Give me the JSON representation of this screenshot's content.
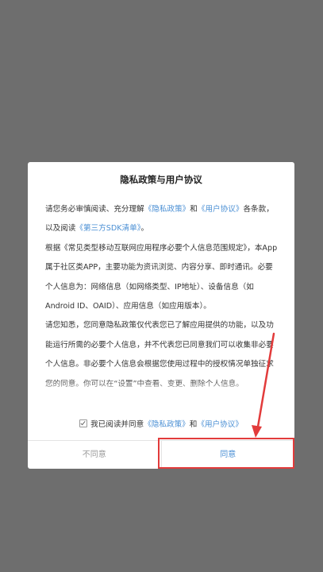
{
  "dialog": {
    "title": "隐私政策与用户协议",
    "paragraph1": {
      "prefix": "请您务必审慎阅读、充分理解",
      "privacy_link": "《隐私政策》",
      "and": "和",
      "terms_link": "《用户协议》",
      "middle": "各条款，以及阅读",
      "sdk_link": "《第三方SDK清单》",
      "end": "。"
    },
    "paragraph2": "根据《常见类型移动互联网应用程序必要个人信息范围规定》，本App属于社区类APP，主要功能为资讯浏览、内容分享、即时通讯。必要个人信息为：网络信息（如网络类型、IP地址）、设备信息（如Android ID、OAID）、应用信息（如应用版本）。",
    "paragraph3": "请您知悉，您同意隐私政策仅代表您已了解应用提供的功能，以及功能运行所需的必要个人信息，并不代表您已同意我们可以收集非必要个人信息。非必要个人信息会根据您使用过程中的授权情况单独征求您的同意。你可以在“设置”中查看、变更、删除个人信息。",
    "consent": {
      "prefix": "我已阅读并同意",
      "privacy_link": "《隐私政策》",
      "and": "和",
      "terms_link": "《用户协议》",
      "checked": true
    },
    "buttons": {
      "disagree": "不同意",
      "agree": "同意"
    }
  },
  "colors": {
    "link": "#4a8fd4",
    "highlight": "#e23b3b",
    "backdrop": "#6e6e6e"
  }
}
